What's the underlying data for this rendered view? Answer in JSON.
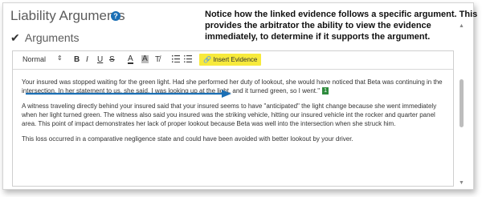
{
  "panel": {
    "title": "Liability Arguments",
    "help_icon": "?",
    "section_check": "✔",
    "section_label": "Arguments"
  },
  "callout": {
    "text": "Notice how the linked evidence follows a specific argument. This provides the arbitrator the ability to view the evidence immediately, to determine if it supports the argument."
  },
  "toolbar": {
    "style_value": "Normal",
    "bold": "B",
    "italic": "I",
    "underline": "U",
    "strike": "S",
    "font_color": "A",
    "highlight": "A",
    "clear_format": "T̸",
    "insert_evidence_label": "Insert Evidence",
    "accent_color": "#f7ea3c"
  },
  "content": {
    "paragraph1": "Your insured was stopped waiting for the green light. Had she performed her duty of lookout, she would have noticed that Beta was continuing in the intersection. In her statement to us, she said, I was looking up at the light, and it turned green, so I went.\"",
    "evidence_badge": "1",
    "paragraph2": "A witness traveling directly behind your insured said that your insured seems to have \"anticipated\" the light change because she went immediately when her light turned green. The witness also said you insured was the striking vehicle, hitting our insured vehicle int the rocker and quarter panel area. This point of impact demonstrates her lack of proper lookout because Beta was well into the intersection when she struck him.",
    "paragraph3": "This loss occurred in a comparative negligence state and could have been avoided with better lookout by your driver."
  }
}
